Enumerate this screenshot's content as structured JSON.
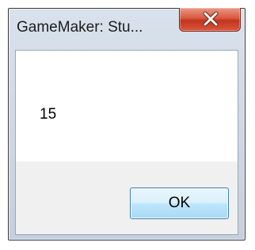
{
  "window": {
    "title": "GameMaker: Stu..."
  },
  "title_bar": {
    "close_icon": "close-x-icon"
  },
  "message": {
    "text": "15"
  },
  "buttons": {
    "ok_label": "OK"
  },
  "colors": {
    "close_button": "#c7432b",
    "ok_button_border": "#3c7fb1",
    "frame": "#d4dde7"
  }
}
